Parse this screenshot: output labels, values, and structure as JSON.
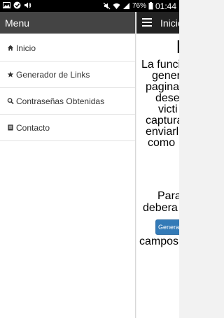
{
  "status_bar": {
    "battery_percent": "76%",
    "time": "01:44"
  },
  "drawer": {
    "title": "Menu",
    "items": [
      {
        "label": "Inicio",
        "icon": "home-icon"
      },
      {
        "label": "Generador de Links",
        "icon": "star-icon"
      },
      {
        "label": "Contraseñas Obtenidas",
        "icon": "search-icon"
      },
      {
        "label": "Contacto",
        "icon": "book-icon"
      }
    ]
  },
  "content": {
    "title": "Inicio",
    "hero_char": "L",
    "paragraph_lines": [
      "La funcio",
      "gener",
      "pagina",
      "desea",
      "victi",
      "captura",
      "enviarl",
      "como"
    ],
    "para2_lines": [
      "Para",
      "debera"
    ],
    "button_label": "Generador",
    "trailing_text": "campos"
  }
}
